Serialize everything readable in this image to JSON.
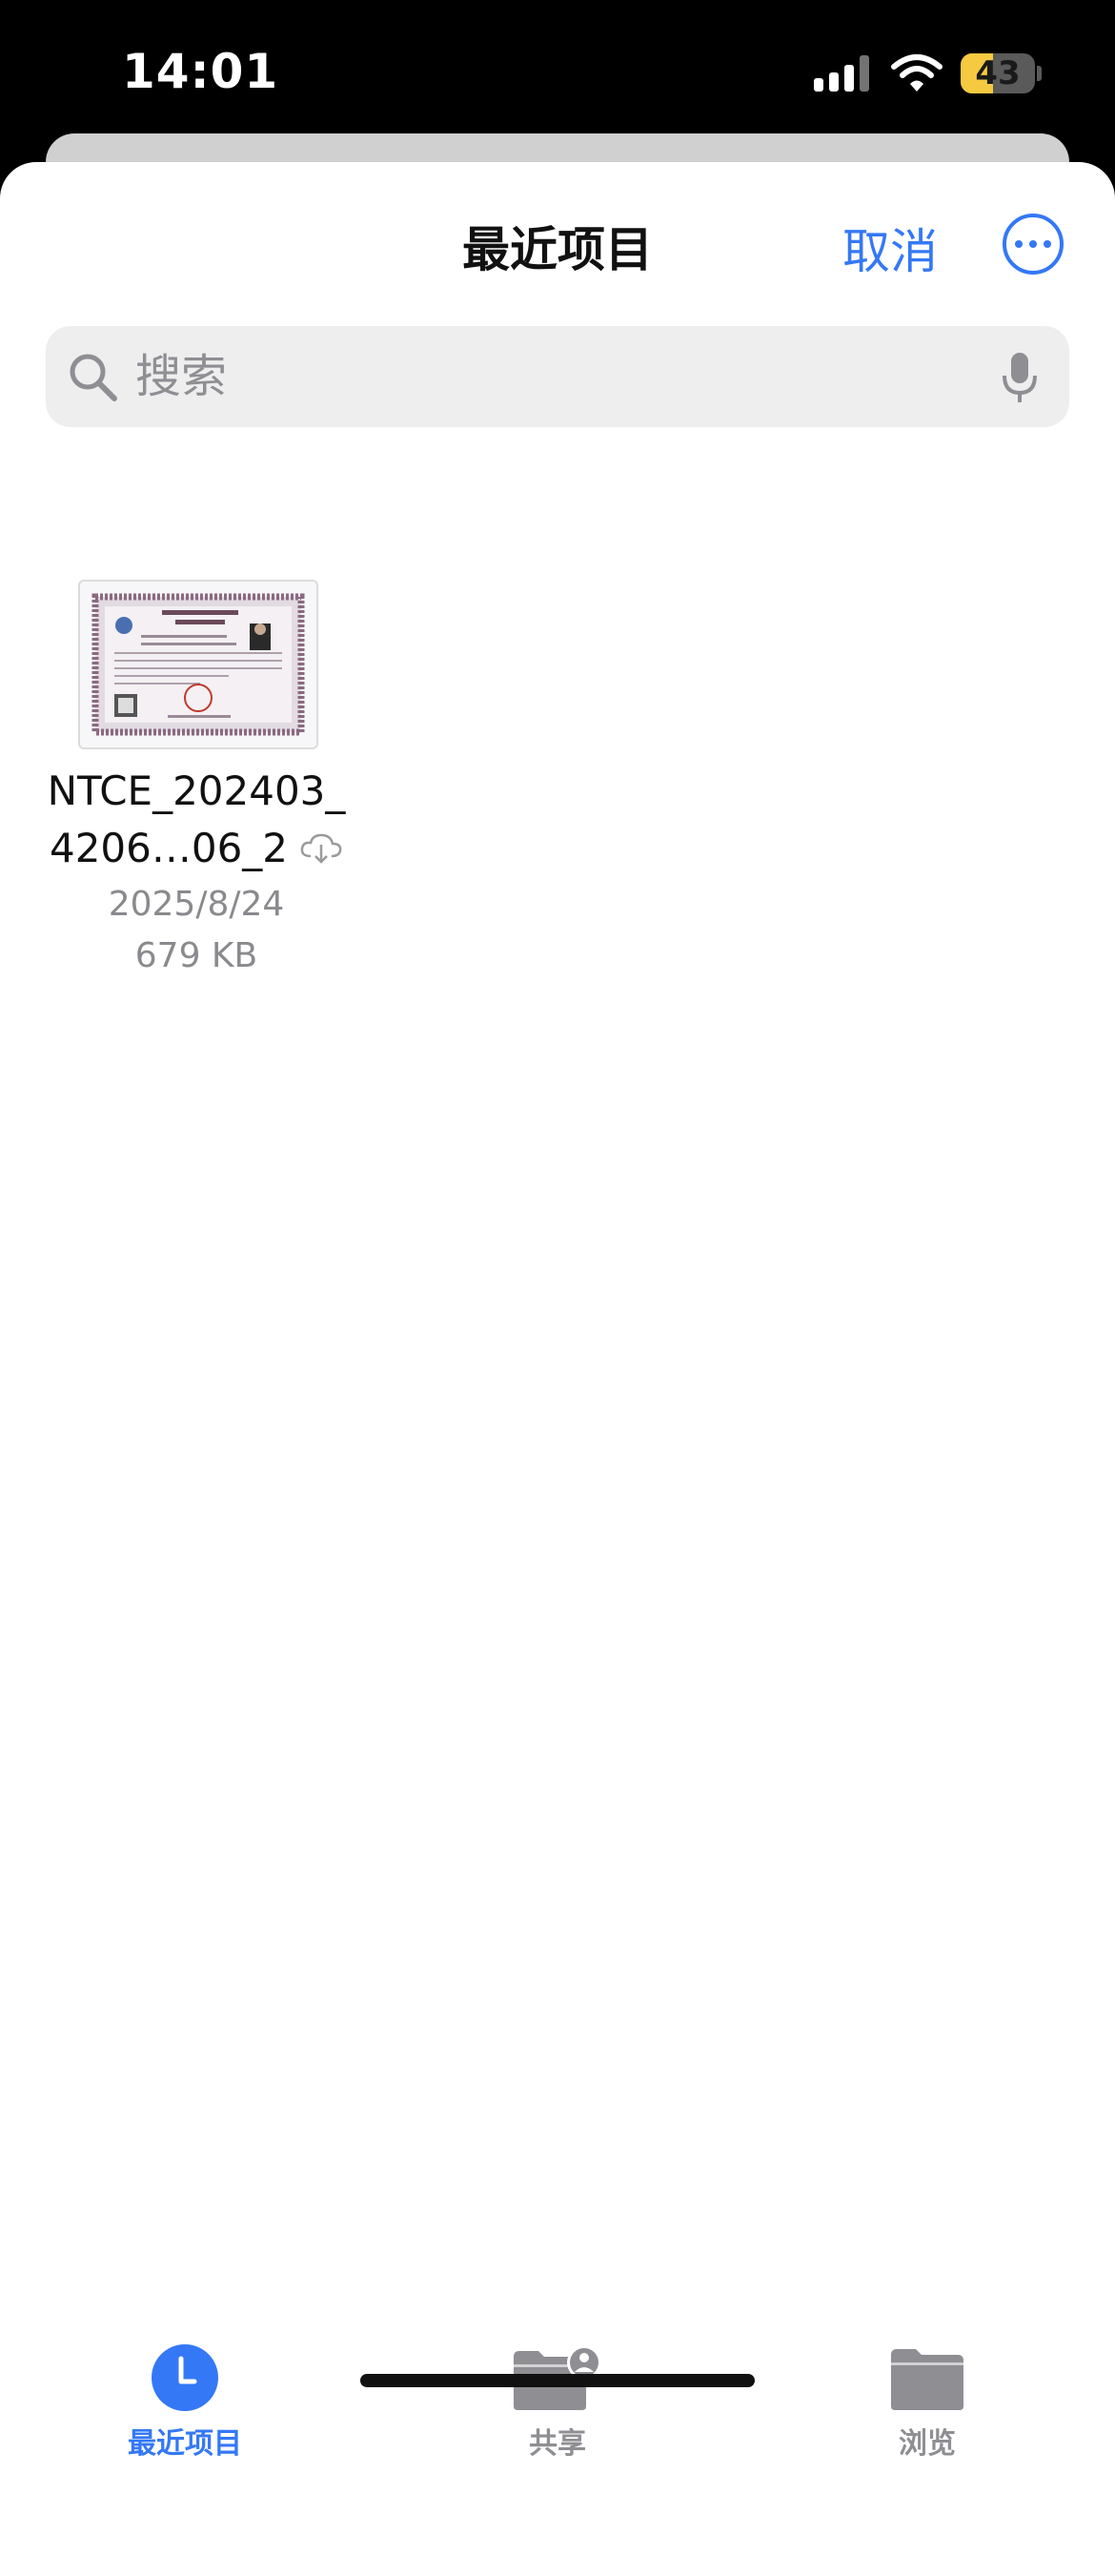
{
  "status_bar": {
    "time": "14:01",
    "battery_level": "43"
  },
  "header": {
    "title": "最近项目",
    "cancel_label": "取消"
  },
  "search": {
    "placeholder": "搜索"
  },
  "files": [
    {
      "name_line1": "NTCE_202403_",
      "name_line2": "4206…06_2",
      "date": "2025/8/24",
      "size": "679 KB",
      "icon": "icloud-download-icon"
    }
  ],
  "tabs": [
    {
      "label": "最近项目",
      "icon": "clock-icon",
      "active": true
    },
    {
      "label": "共享",
      "icon": "shared-folder-icon",
      "active": false
    },
    {
      "label": "浏览",
      "icon": "folder-icon",
      "active": false
    }
  ],
  "colors": {
    "accent": "#3478f6",
    "inactive": "#8e8e93",
    "battery": "#f5c940"
  }
}
